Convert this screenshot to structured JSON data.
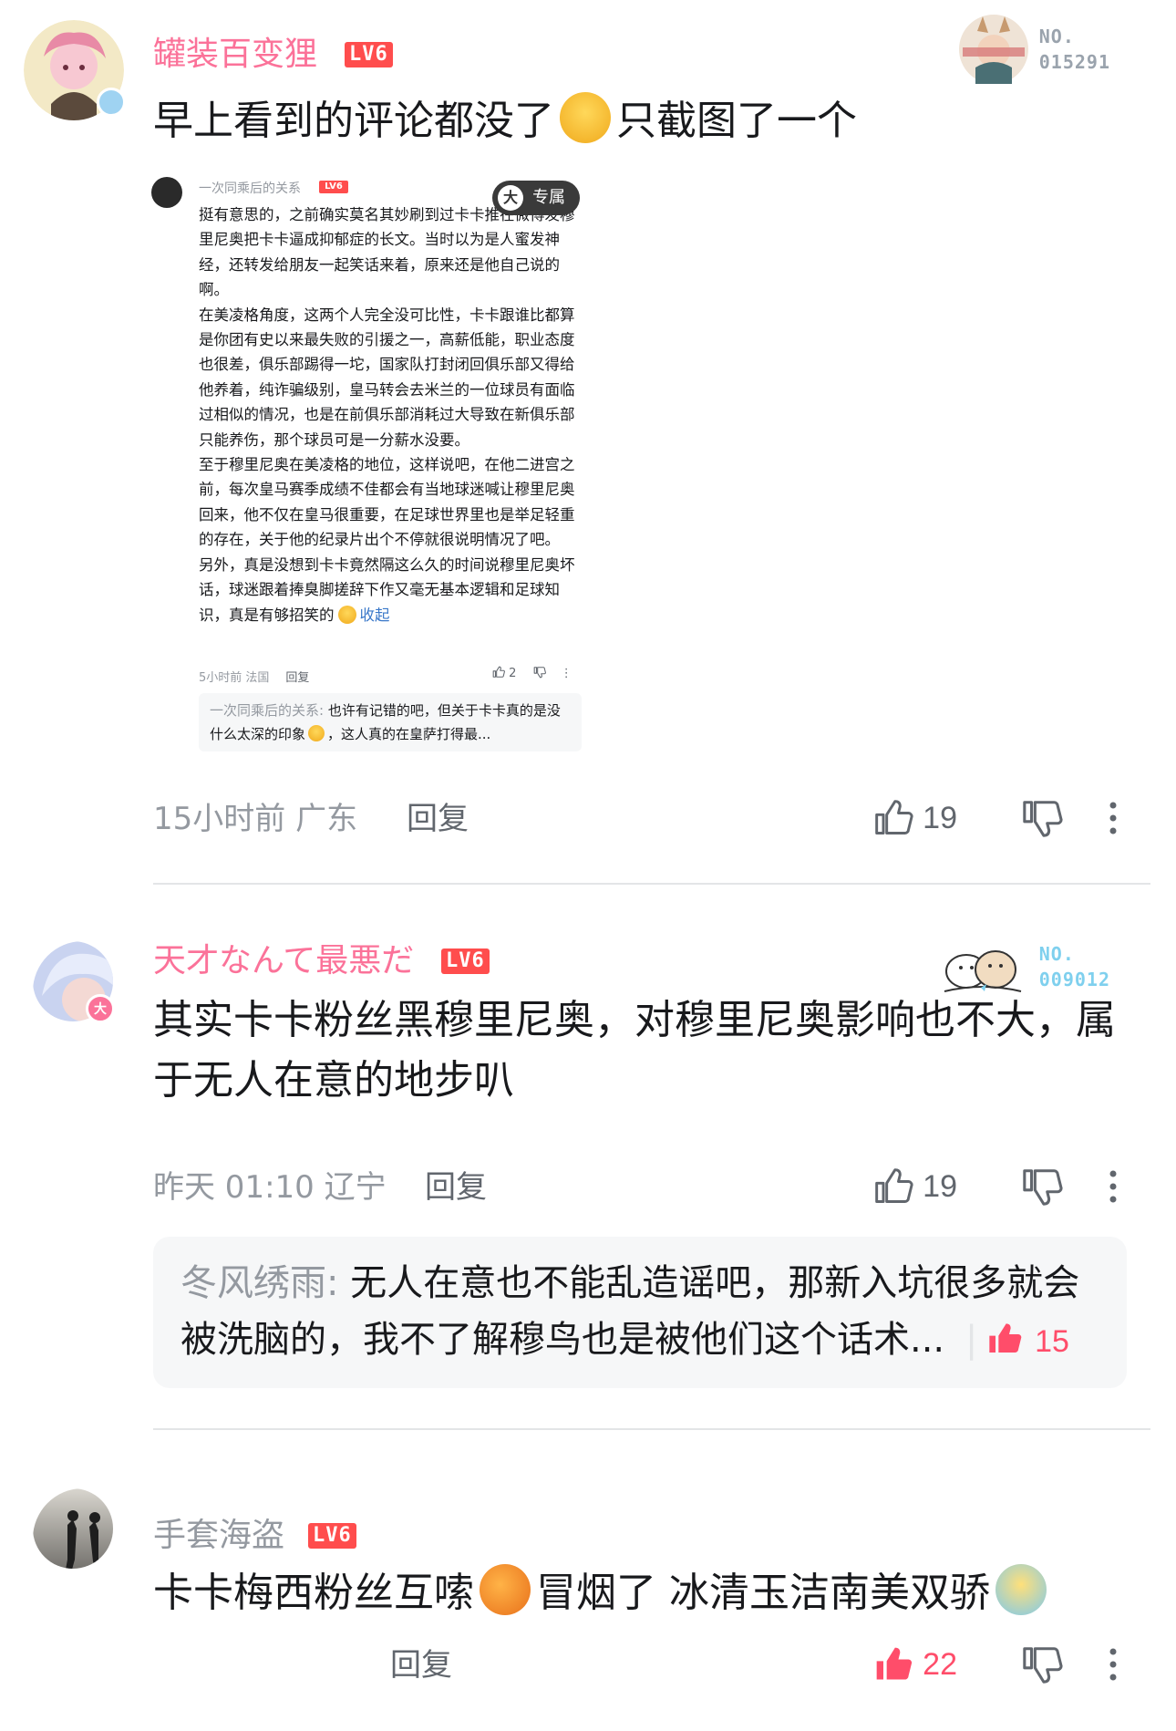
{
  "comments": [
    {
      "username": "罐装百变狸",
      "level": "LV6",
      "fan_card": {
        "label": "NO.",
        "number": "015291"
      },
      "text_parts": [
        "早上看到的评论都没了",
        "只截图了一个"
      ],
      "meta": "15小时前 广东",
      "reply_label": "回复",
      "likes": "19",
      "avatar_badge": "",
      "screenshot": {
        "username": "一次同乘后的关系",
        "level": "LV6",
        "tag": "专属",
        "tag_icon": "大",
        "body": "挺有意思的，之前确实莫名其妙刷到过卡卡推在微博发穆里尼奥把卡卡逼成抑郁症的长文。当时以为是人蜜发神经，还转发给朋友一起笑话来着，原来还是他自己说的啊。\n在美凌格角度，这两个人完全没可比性，卡卡跟谁比都算是你团有史以来最失败的引援之一，高薪低能，职业态度也很差，俱乐部踢得一坨，国家队打封闭回俱乐部又得给他养着，纯诈骗级别，皇马转会去米兰的一位球员有面临过相似的情况，也是在前俱乐部消耗过大导致在新俱乐部只能养伤，那个球员可是一分薪水没要。\n至于穆里尼奥在美凌格的地位，这样说吧，在他二进宫之前，每次皇马赛季成绩不佳都会有当地球迷喊让穆里尼奥回来，他不仅在皇马很重要，在足球世界里也是举足轻重的存在，关于他的纪录片出个不停就很说明情况了吧。\n另外，真是没想到卡卡竟然隔这么久的时间说穆里尼奥坏话，球迷跟着捧臭脚搓辞下作又毫无基本逻辑和足球知识，真是有够招笑的",
        "collapse": "收起",
        "meta": "5小时前 法国",
        "reply_label": "回复",
        "likes": "2",
        "reply_name": "一次同乘后的关系:",
        "reply_text": " 也许有记错的吧，但关于卡卡真的是没什么太深的印象",
        "reply_text2": "，这人真的在皇萨打得最..."
      }
    },
    {
      "username": "天才なんて最悪だ",
      "level": "LV6",
      "fan_card": {
        "label": "NO.",
        "number": "009012"
      },
      "text": "其实卡卡粉丝黑穆里尼奥，对穆里尼奥影响也不大，属于无人在意的地步叭",
      "meta": "昨天 01:10 辽宁",
      "reply_label": "回复",
      "likes": "19",
      "avatar_badge": "大",
      "sub_reply": {
        "name": "冬风绣雨:",
        "text": " 无人在意也不能乱造谣吧，那新入坑很多就会被洗脑的，我不了解穆鸟也是被他们这个话术...",
        "likes": "15"
      }
    },
    {
      "username": "手套海盗",
      "level": "LV6",
      "text_parts": [
        "卡卡梅西粉丝互嗦",
        "冒烟了  冰清玉洁南美双骄"
      ],
      "reply_label": "回复",
      "likes": "22"
    }
  ],
  "colors": {
    "pink_name": "#fb7299",
    "gray_name": "#9499a0",
    "level_badge": "#ff4d4d",
    "liked": "#ff4d6a",
    "fan_card_1": "#9aa3ad",
    "fan_card_2": "#7fd0ee"
  },
  "icons": [
    "thumb-up-icon",
    "thumb-down-icon",
    "more-icon",
    "laugh-cry-emoji",
    "orange-emoji",
    "shrug-emoji"
  ]
}
